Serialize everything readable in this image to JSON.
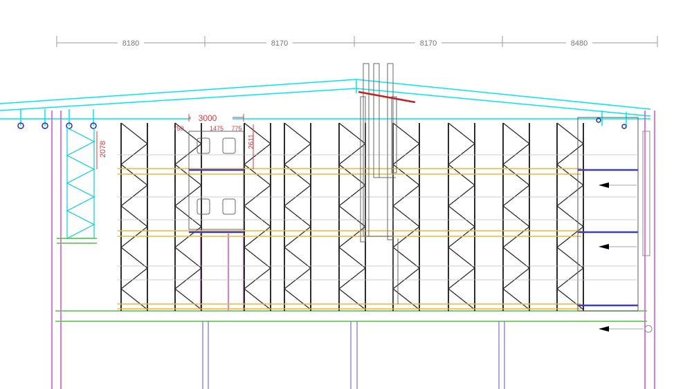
{
  "drawing": {
    "top_dimensions": [
      "8180",
      "8170",
      "8170",
      "8480"
    ],
    "opening_width": "3000",
    "opening_subdims": [
      "750",
      "1475",
      "775"
    ],
    "vertical_dims": [
      "2078",
      "2611"
    ]
  },
  "colors": {
    "rack_frame": "#2b2b2b",
    "beam": "#f2b632",
    "roof": "#00e5f0",
    "column": "#d94ad9",
    "floor": "#4cc43c",
    "dimension": "#9a9a9a",
    "annotation": "#e0343a",
    "blue_beam": "#3b3bc8",
    "pipe_red": "#c02020"
  }
}
